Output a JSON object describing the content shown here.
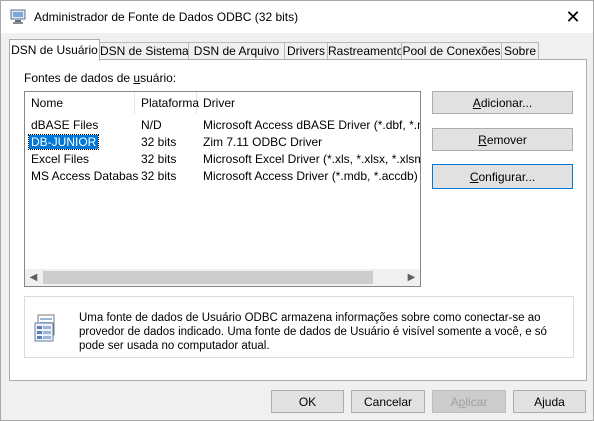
{
  "window": {
    "title": "Administrador de Fonte de Dados ODBC (32 bits)",
    "close_glyph": "✕"
  },
  "tabs": [
    {
      "label": "DSN de Usuário",
      "active": true
    },
    {
      "label": "DSN de Sistema"
    },
    {
      "label": "DSN de Arquivo"
    },
    {
      "label": "Drivers"
    },
    {
      "label": "Rastreamento"
    },
    {
      "label": "Pool de Conexões"
    },
    {
      "label": "Sobre"
    }
  ],
  "panel": {
    "section_label_prefix": "Fontes de dados de ",
    "section_label_underlined": "u",
    "section_label_suffix": "suário:"
  },
  "list": {
    "columns": [
      "Nome",
      "Plataforma",
      "Driver"
    ],
    "rows": [
      [
        "dBASE Files",
        "N/D",
        "Microsoft Access dBASE Driver (*.dbf, *.ndx, *.mdx)"
      ],
      [
        "DB-JUNIOR",
        "32 bits",
        "Zim 7.11 ODBC Driver"
      ],
      [
        "Excel Files",
        "32 bits",
        "Microsoft Excel Driver (*.xls, *.xlsx, *.xlsm, *.xlsb)"
      ],
      [
        "MS Access Database",
        "32 bits",
        "Microsoft Access Driver (*.mdb, *.accdb)"
      ]
    ],
    "selected_row": 1,
    "scroll_left_glyph": "◀",
    "scroll_right_glyph": "▶"
  },
  "side_buttons": {
    "add": {
      "pre": "",
      "key": "A",
      "post": "dicionar..."
    },
    "remove": {
      "pre": "",
      "key": "R",
      "post": "emover"
    },
    "configure": {
      "pre": "",
      "key": "C",
      "post": "onfigurar..."
    }
  },
  "info": {
    "icon": "data-sources-icon",
    "text": "Uma fonte de dados de Usuário ODBC armazena informações sobre como conectar-se ao provedor de dados indicado. Uma fonte de dados de Usuário é visível somente a você, e só pode ser usada no computador atual."
  },
  "footer": {
    "ok": "OK",
    "cancel": "Cancelar",
    "apply_pre": "A",
    "apply_key": "p",
    "apply_post": "licar",
    "help": "Ajuda"
  },
  "colors": {
    "selection": "#0078d7",
    "focus_border": "#0078d7"
  }
}
